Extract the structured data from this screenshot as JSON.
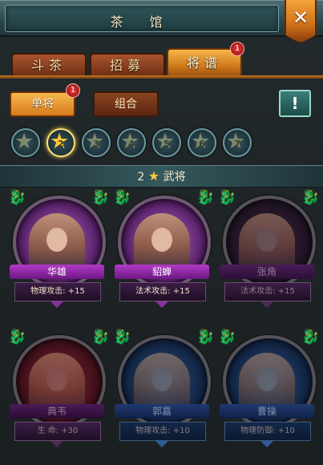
{
  "header": {
    "title": "茶 馆"
  },
  "tabs": [
    {
      "label": "斗茶",
      "active": false
    },
    {
      "label": "招募",
      "active": false
    },
    {
      "label": "将谱",
      "active": true,
      "badge": "1"
    }
  ],
  "sub_tabs": [
    {
      "label": "单将",
      "active": true,
      "badge": "1"
    },
    {
      "label": "组合",
      "active": false
    }
  ],
  "info_button": {
    "label": "!"
  },
  "star_levels": [
    {
      "label": "",
      "selected": false
    },
    {
      "label": "2",
      "selected": true
    },
    {
      "label": "3",
      "selected": false
    },
    {
      "label": "4",
      "selected": false
    },
    {
      "label": "5",
      "selected": false
    },
    {
      "label": "6",
      "selected": false
    },
    {
      "label": "7",
      "selected": false
    }
  ],
  "section": {
    "prefix": "2",
    "suffix": "武将"
  },
  "cards": [
    {
      "name": "华雄",
      "stat": "物理攻击: +15",
      "style": "purple",
      "unlocked": true
    },
    {
      "name": "貂蝉",
      "stat": "法术攻击: +15",
      "style": "purple",
      "unlocked": true
    },
    {
      "name": "张角",
      "stat": "法术攻击: +15",
      "style": "dark",
      "unlocked": false
    },
    {
      "name": "典韦",
      "stat": "生    命: +30",
      "style": "red",
      "unlocked": false
    },
    {
      "name": "郭嘉",
      "stat": "物理攻击: +10",
      "style": "blue",
      "unlocked": false
    },
    {
      "name": "曹操",
      "stat": "物理防御: +10",
      "style": "blue",
      "unlocked": false
    }
  ],
  "colors": {
    "accent_orange": "#f5b548",
    "teal_header": "#35585d",
    "purple_ribbon": "#b33ac8",
    "badge_red": "#e33a3a"
  }
}
